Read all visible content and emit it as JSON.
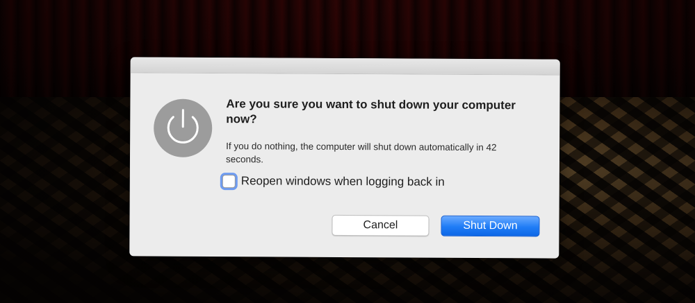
{
  "dialog": {
    "icon": "power-icon",
    "heading": "Are you sure you want to shut down your computer now?",
    "message": "If you do nothing, the computer will shut down automatically in 42 seconds.",
    "countdown_seconds": 42,
    "checkbox": {
      "label": "Reopen windows when logging back in",
      "checked": false
    },
    "buttons": {
      "cancel_label": "Cancel",
      "confirm_label": "Shut Down"
    }
  },
  "colors": {
    "accent": "#1f7cf6",
    "focus_ring": "#6f9cf0",
    "dialog_bg": "#ececec"
  }
}
